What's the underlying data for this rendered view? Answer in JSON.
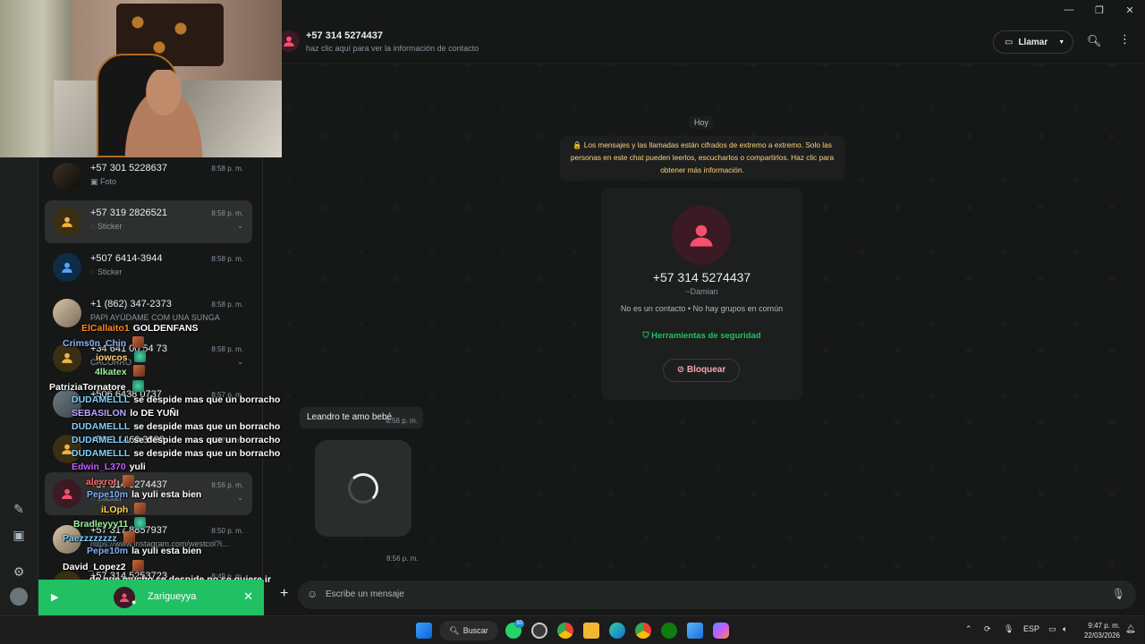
{
  "window": {
    "controls": [
      "—",
      "❐",
      "✕"
    ]
  },
  "chat_list": [
    {
      "name": "+57 301 5228637",
      "time": "8:58 p. m.",
      "sub": "Foto",
      "sub_icon": "photo-icon",
      "avatar": "dark"
    },
    {
      "name": "+57 319 2826521",
      "time": "8:58 p. m.",
      "sub": "Sticker",
      "sub_icon": "sticker-icon",
      "avatar": "yel",
      "selected": true
    },
    {
      "name": "+507 6414-3944",
      "time": "8:58 p. m.",
      "sub": "Sticker",
      "sub_icon": "sticker-icon",
      "avatar": "blue"
    },
    {
      "name": "+1 (862) 347-2373",
      "time": "8:58 p. m.",
      "sub": "PAPI AYÚDAME COM UNA SUNGA",
      "avatar": "photo"
    },
    {
      "name": "+34 641 00 54 73",
      "time": "8:58 p. m.",
      "sub": "CACORRO",
      "avatar": "yel"
    },
    {
      "name": "+506 6438 0737",
      "time": "8:57 p. m.",
      "sub": "",
      "avatar": "gray"
    },
    {
      "name": "+56 9 1462 3882",
      "time": "8:57 p. m.",
      "sub": "",
      "avatar": "yel"
    },
    {
      "name": "+57 314 5274437",
      "time": "8:56 p. m.",
      "sub": "Sticker",
      "sub_icon": "sticker-icon",
      "avatar": "red",
      "selected": true
    },
    {
      "name": "+57 317 8857937",
      "time": "8:50 p. m.",
      "sub": "https://www.instagram.com/westcol?i...",
      "avatar": "photo"
    },
    {
      "name": "+57 314 5253723",
      "time": "8:49 p. m.",
      "sub": "",
      "avatar": "yel"
    }
  ],
  "stream_chat": [
    {
      "user": "ElCallaito1",
      "color": "#ff8c1a",
      "text": "GOLDENFANS"
    },
    {
      "user": "Crims0n_Chin",
      "color": "#8ab4f8",
      "text": ""
    },
    {
      "user": "iowcos",
      "color": "#ffd27f",
      "text": ""
    },
    {
      "user": "4lkatex",
      "color": "#9ef0a0",
      "text": ""
    },
    {
      "user": "PatriziaTornatore",
      "color": "#ffffff",
      "text": ""
    },
    {
      "user": "DUDAMELLL",
      "color": "#7fd1ff",
      "text": "se despide mas que un borracho"
    },
    {
      "user": "SEBASILON",
      "color": "#b9a6ff",
      "text": "lo DE YUÑI"
    },
    {
      "user": "DUDAMELLL",
      "color": "#7fd1ff",
      "text": "se despide mas que un borracho"
    },
    {
      "user": "DUDAMELLL",
      "color": "#7fd1ff",
      "text": "se despide mas que un borracho"
    },
    {
      "user": "DUDAMELLL",
      "color": "#7fd1ff",
      "text": "se despide mas que un borracho"
    },
    {
      "user": "Edwin_L370",
      "color": "#c55cff",
      "text": "yuli"
    },
    {
      "user": "alexrot",
      "color": "#ff6b6b",
      "text": ""
    },
    {
      "user": "Pepe10m",
      "color": "#7fb2ff",
      "text": "la yuli esta bien"
    },
    {
      "user": "iLOph",
      "color": "#ffd84d",
      "text": ""
    },
    {
      "user": "Bradleyyy11",
      "color": "#9ef0a0",
      "text": ""
    },
    {
      "user": "Paezzzzzzzz",
      "color": "#7fd1ff",
      "text": ""
    },
    {
      "user": "Pepe10m",
      "color": "#7fb2ff",
      "text": "la yuli esta bien"
    },
    {
      "user": "David_Lopez2",
      "color": "#ffffff",
      "text": ""
    },
    {
      "user": "",
      "color": "#ffffff",
      "text": "de que mucho se despide no se quiere ir"
    }
  ],
  "now_playing": {
    "name": "Zarigueyya"
  },
  "header": {
    "title": "+57 314 5274437",
    "subtitle": "haz clic aquí para ver la información de contacto",
    "call_label": "Llamar"
  },
  "conversation": {
    "day": "Hoy",
    "encryption_notice": "🔒 Los mensajes y las llamadas están cifrados de extremo a extremo. Solo las personas en este chat pueden leerlos, escucharlos o compartirlos. Haz clic para obtener más información.",
    "contact_card": {
      "number": "+57 314 5274437",
      "alias": "~Damian",
      "info": "No es un contacto • No hay grupos en común",
      "security": "Herramientas de seguridad",
      "block": "Bloquear"
    },
    "messages": [
      {
        "text": "Leandro te amo bebé",
        "time": "8:56 p. m."
      },
      {
        "type": "media",
        "time": "8:56 p. m."
      }
    ],
    "input_placeholder": "Escribe un mensaje"
  },
  "taskbar": {
    "search_label": "Buscar",
    "whatsapp_badge": "30",
    "language": "ESP",
    "time": "9:47 p. m.",
    "date": "22/03/2026"
  }
}
